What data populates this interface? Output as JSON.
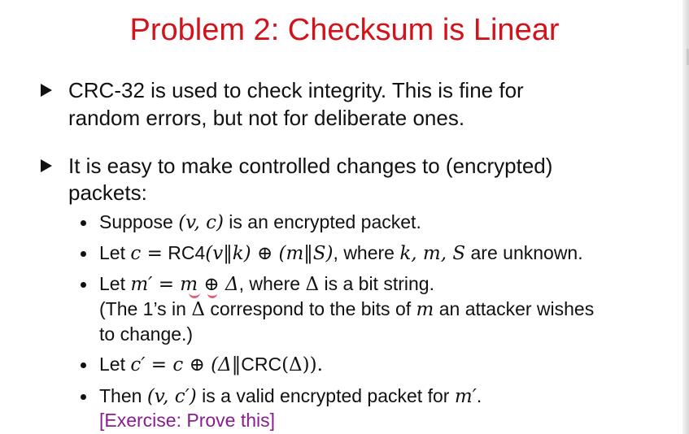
{
  "slide": {
    "title": "Problem 2: Checksum is Linear",
    "bullet1": {
      "line1": "CRC-32 is used to check integrity. This is fine for",
      "line2": "random errors, but not for deliberate ones."
    },
    "bullet2": {
      "line1": "It is easy to make controlled changes to (encrypted)",
      "line2": "packets:"
    },
    "sub1": {
      "text1": "Suppose ",
      "math": "(v, c)",
      "text2": " is an encrypted packet."
    },
    "sub2": {
      "text1": "Let ",
      "math1": "c =",
      "rc4": " RC4",
      "math2": "(v‖k) ⊕ (m‖S)",
      "text2": ", where ",
      "math3": "k, m, S",
      "text3": " are unknown."
    },
    "sub3": {
      "text1": "Let ",
      "math1": "m′ = m ⊕ Δ",
      "text2": ", where ",
      "math2": "Δ",
      "text3": " is a bit string.",
      "line2a": "(The 1’s in ",
      "line2math": "Δ",
      "line2b": " correspond to the bits of ",
      "line2math2": "m",
      "line2c": " an attacker wishes",
      "line3": "to change.)"
    },
    "sub4": {
      "text1": "Let ",
      "math1": "c′ = c ⊕ (Δ‖",
      "crc": "CRC",
      "math2": "(Δ)).",
      "text2": ""
    },
    "sub5": {
      "text1": "Then ",
      "math1": "(v, c′)",
      "text2": " is a valid encrypted packet for ",
      "math2": "m′",
      "text3": "."
    },
    "exercise": "[Exercise: Prove this]"
  }
}
